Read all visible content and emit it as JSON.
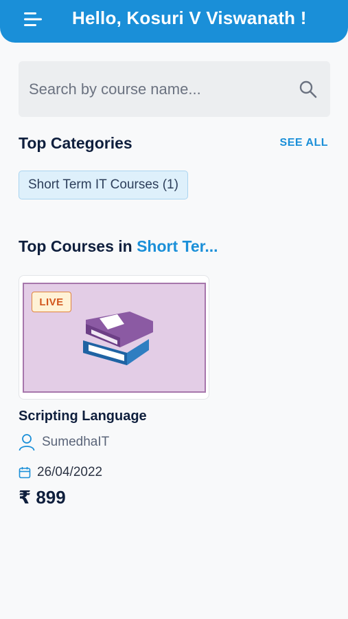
{
  "header": {
    "greeting": "Hello, Kosuri V Viswanath !"
  },
  "search": {
    "placeholder": "Search by course name..."
  },
  "categories": {
    "title": "Top Categories",
    "see_all": "SEE ALL",
    "items": [
      {
        "label": "Short Term IT Courses (1)"
      }
    ]
  },
  "top_courses": {
    "title_prefix": "Top Courses in ",
    "title_highlight": "Short Ter..."
  },
  "course": {
    "badge": "LIVE",
    "name": "Scripting Language",
    "instructor": "SumedhaIT",
    "date": "26/04/2022",
    "price": "₹ 899"
  },
  "colors": {
    "accent": "#1a8fd8",
    "live_badge": "#d2551d",
    "thumbnail_bg": "#e3cde6"
  }
}
